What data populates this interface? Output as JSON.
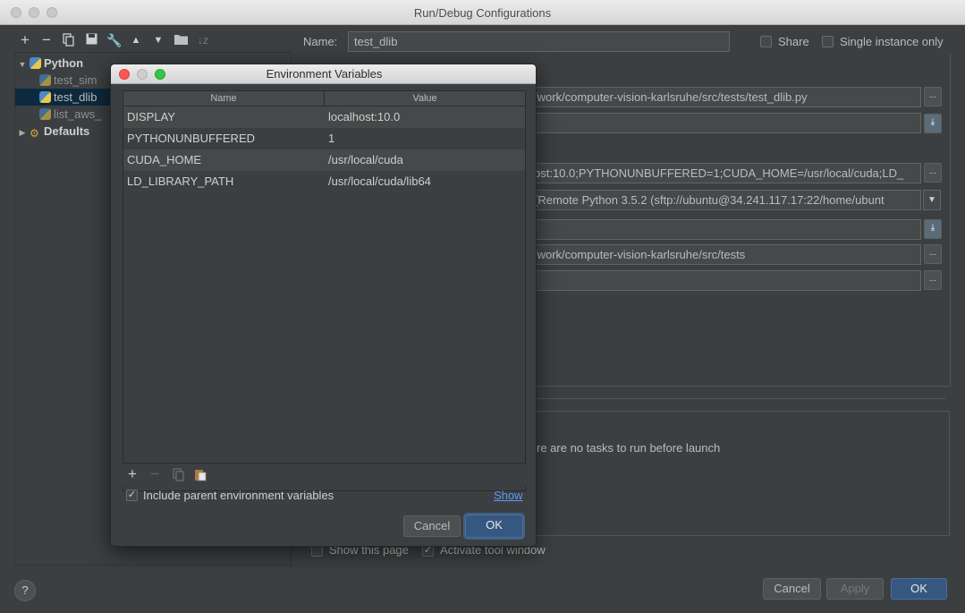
{
  "window": {
    "title": "Run/Debug Configurations"
  },
  "toolbar": {
    "icons": [
      "add-icon",
      "remove-icon",
      "copy-icon",
      "save-icon",
      "wrench-icon",
      "move-up-icon",
      "move-down-icon",
      "folder-icon",
      "sort-icon"
    ],
    "add": "+",
    "remove": "−"
  },
  "tree": {
    "python_label": "Python",
    "items": [
      "test_sim",
      "test_dlib",
      "list_aws_"
    ],
    "defaults_label": "Defaults"
  },
  "config": {
    "name_label": "Name:",
    "name_value": "test_dlib",
    "share_label": "Share",
    "single_instance_label": "Single instance only",
    "script_path": "/work/computer-vision-karlsruhe/src/tests/test_dlib.py",
    "env_vars": "ost:10.0;PYTHONUNBUFFERED=1;CUDA_HOME=/usr/local/cuda;LD_",
    "interpreter": "(Remote Python 3.5.2 (sftp://ubuntu@34.241.117.17:22/home/ubunt",
    "working_dir": "/work/computer-vision-karlsruhe/src/tests",
    "tasks_text": "re are no tasks to run before launch",
    "show_page_label": "Show this page",
    "activate_tool_label": "Activate tool window",
    "dots": "..."
  },
  "footer": {
    "help": "?",
    "cancel": "Cancel",
    "apply": "Apply",
    "ok": "OK"
  },
  "dialog": {
    "title": "Environment Variables",
    "col_name": "Name",
    "col_value": "Value",
    "rows": [
      {
        "name": "DISPLAY",
        "value": "localhost:10.0"
      },
      {
        "name": "PYTHONUNBUFFERED",
        "value": "1"
      },
      {
        "name": "CUDA_HOME",
        "value": "/usr/local/cuda"
      },
      {
        "name": "LD_LIBRARY_PATH",
        "value": "/usr/local/cuda/lib64"
      }
    ],
    "include_parent_label": "Include parent environment variables",
    "show_link": "Show",
    "cancel": "Cancel",
    "ok": "OK"
  },
  "colors": {
    "accent": "#365880",
    "selection": "#0d293e",
    "link": "#589df6"
  }
}
